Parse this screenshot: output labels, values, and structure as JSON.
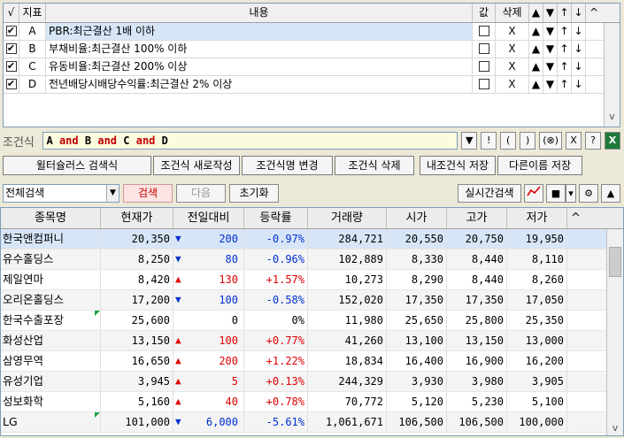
{
  "cond_grid": {
    "headers": {
      "check": "√",
      "id": "지표",
      "content": "내용",
      "value": "값",
      "delete": "삭제",
      "up": "▲",
      "down": "▼",
      "move_up": "↑",
      "move_down": "↓"
    },
    "rows": [
      {
        "checked": "✔",
        "id": "A",
        "content": "PBR:최근결산 1배 이하",
        "delete": "X"
      },
      {
        "checked": "✔",
        "id": "B",
        "content": "부채비율:최근결산 100% 이하",
        "delete": "X"
      },
      {
        "checked": "✔",
        "id": "C",
        "content": "유동비율:최근결산 200% 이상",
        "delete": "X"
      },
      {
        "checked": "✔",
        "id": "D",
        "content": "전년배당시배당수익률:최근결산 2% 이상",
        "delete": "X"
      }
    ]
  },
  "formula": {
    "label": "조건식",
    "tokens": [
      "A",
      "and",
      "B",
      "and",
      "C",
      "and",
      "D"
    ],
    "buttons": [
      "▼",
      "!",
      "(",
      ")",
      "(⊗)",
      "X",
      "?",
      "X"
    ]
  },
  "toolbar": {
    "thesaurus": "윌터슐러스 검색식",
    "new": "조건식 새로작성",
    "rename": "조건식명 변경",
    "delete": "조건식 삭제",
    "save_mine": "내조건식 저장",
    "save_as": "다른이름 저장"
  },
  "search": {
    "scope": "전체검색",
    "search": "검색",
    "next": "다음",
    "reset": "초기화",
    "realtime": "실시간검색"
  },
  "results": {
    "headers": [
      "종목명",
      "현재가",
      "전일대비",
      "등락률",
      "거래량",
      "시가",
      "고가",
      "저가"
    ],
    "rows": [
      {
        "name": "한국앤컴퍼니",
        "price": "20,350",
        "dir": "down",
        "diff": "200",
        "rate": "-0.97%",
        "vol": "284,721",
        "open": "20,550",
        "high": "20,750",
        "low": "19,950"
      },
      {
        "name": "유수홀딩스",
        "price": "8,250",
        "dir": "down",
        "diff": "80",
        "rate": "-0.96%",
        "vol": "102,889",
        "open": "8,330",
        "high": "8,440",
        "low": "8,110"
      },
      {
        "name": "제일연마",
        "price": "8,420",
        "dir": "up",
        "diff": "130",
        "rate": "+1.57%",
        "vol": "10,273",
        "open": "8,290",
        "high": "8,440",
        "low": "8,260"
      },
      {
        "name": "오리온홀딩스",
        "price": "17,200",
        "dir": "down",
        "diff": "100",
        "rate": "-0.58%",
        "vol": "152,020",
        "open": "17,350",
        "high": "17,350",
        "low": "17,050"
      },
      {
        "name": "한국수출포장",
        "price": "25,600",
        "dir": "flat",
        "diff": "0",
        "rate": "0%",
        "vol": "11,980",
        "open": "25,650",
        "high": "25,800",
        "low": "25,350"
      },
      {
        "name": "화성산업",
        "price": "13,150",
        "dir": "up",
        "diff": "100",
        "rate": "+0.77%",
        "vol": "41,260",
        "open": "13,100",
        "high": "13,150",
        "low": "13,000"
      },
      {
        "name": "삼영무역",
        "price": "16,650",
        "dir": "up",
        "diff": "200",
        "rate": "+1.22%",
        "vol": "18,834",
        "open": "16,400",
        "high": "16,900",
        "low": "16,200"
      },
      {
        "name": "유성기업",
        "price": "3,945",
        "dir": "up",
        "diff": "5",
        "rate": "+0.13%",
        "vol": "244,329",
        "open": "3,930",
        "high": "3,980",
        "low": "3,905"
      },
      {
        "name": "성보화학",
        "price": "5,160",
        "dir": "up",
        "diff": "40",
        "rate": "+0.78%",
        "vol": "70,772",
        "open": "5,120",
        "high": "5,230",
        "low": "5,100"
      },
      {
        "name": "LG",
        "price": "101,000",
        "dir": "down",
        "diff": "6,000",
        "rate": "-5.61%",
        "vol": "1,061,671",
        "open": "106,500",
        "high": "106,500",
        "low": "100,000"
      }
    ]
  }
}
